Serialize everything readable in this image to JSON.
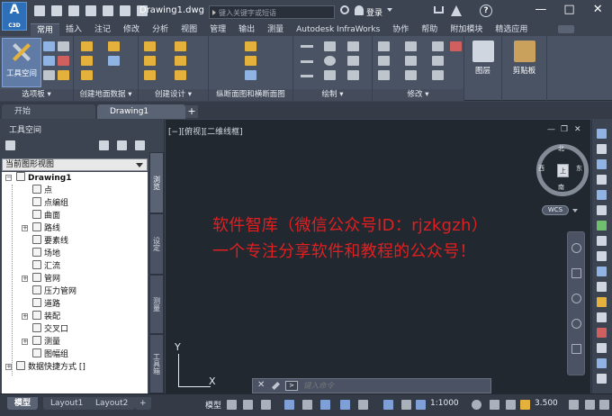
{
  "title_bar": {
    "app_logo_letter": "A",
    "app_logo_sub": "C3D",
    "document_title": "Drawing1.dwg",
    "search_placeholder": "键入关键字或短语",
    "login_label": "登录",
    "help_label": "?",
    "window_buttons": [
      "—",
      "□",
      "✕"
    ]
  },
  "ribbon_tabs": [
    "常用",
    "插入",
    "注记",
    "修改",
    "分析",
    "视图",
    "管理",
    "输出",
    "测量",
    "Autodesk InfraWorks",
    "协作",
    "帮助",
    "附加模块",
    "精选应用"
  ],
  "ribbon_active_tab": "常用",
  "ribbon_panels": [
    {
      "label": "选项板 ▾"
    },
    {
      "label": "创建地面数据 ▾"
    },
    {
      "label": "创建设计 ▾"
    },
    {
      "label": "纵断面图和横断面图"
    },
    {
      "label": "绘制 ▾"
    },
    {
      "label": "修改 ▾"
    },
    {
      "label": "图层"
    },
    {
      "label": "剪贴板"
    }
  ],
  "toolspace_button": "工具空间",
  "doc_tabs": {
    "start": "开始",
    "drawing": "Drawing1",
    "add": "+"
  },
  "toolspace": {
    "title": "工具空间",
    "view_select": "当前图形视图",
    "tree": [
      {
        "label": "Drawing1",
        "root": true
      },
      {
        "label": "点"
      },
      {
        "label": "点编组"
      },
      {
        "label": "曲面"
      },
      {
        "label": "路线",
        "expandable": true
      },
      {
        "label": "要素线"
      },
      {
        "label": "场地"
      },
      {
        "label": "汇流"
      },
      {
        "label": "管网",
        "expandable": true
      },
      {
        "label": "压力管网"
      },
      {
        "label": "道路"
      },
      {
        "label": "装配",
        "expandable": true
      },
      {
        "label": "交叉口"
      },
      {
        "label": "测量",
        "expandable": true
      },
      {
        "label": "图幅组"
      },
      {
        "label": "数据快捷方式 []",
        "expandable": true
      }
    ],
    "vertical_tabs": [
      "浏览",
      "设定",
      "测量",
      "工具箱"
    ]
  },
  "viewport": {
    "label": "[−][俯视][二维线框]",
    "watermark_line1": "软件智库（微信公众号ID：rjzkgzh）",
    "watermark_line2": "一个专注分享软件和教程的公众号！",
    "compass": {
      "n": "北",
      "s": "南",
      "e": "东",
      "w": "西"
    },
    "cube_face": "上",
    "wcs": "WCS",
    "ucs_y": "Y",
    "ucs_x": "X",
    "cmd_placeholder": "键入命令"
  },
  "status_bar": {
    "tabs": [
      "模型",
      "Layout1",
      "Layout2"
    ],
    "add_tab": "+",
    "model_button": "模型",
    "scale": "1:1000",
    "value": "3.500"
  },
  "colors": {
    "watermark": "#e02020",
    "viewport_bg": "#212830",
    "chrome_bg": "#3c4452",
    "accent": "#5f7ba6"
  }
}
